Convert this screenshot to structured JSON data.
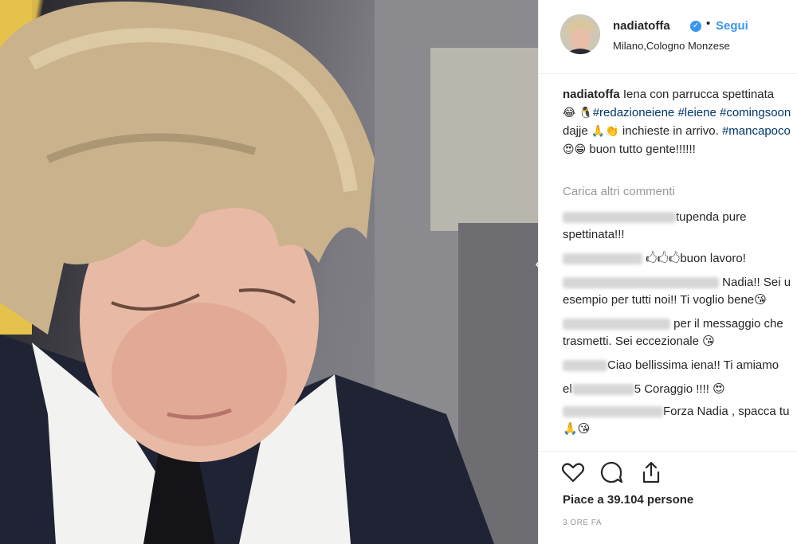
{
  "post": {
    "username": "nadiatoffa",
    "verified_mark": "✓",
    "separator": "•",
    "follow_label": "Segui",
    "location": "Milano,Cologno Monzese"
  },
  "caption": {
    "username": "nadiatoffa",
    "text1": " Iena con parrucca spettinata ",
    "emoji1": "😂 🐧 ",
    "tag1": "#redazioneiene",
    "tag2": " #leiene",
    "tag3": "#comingsoon",
    "text2": " dajje ",
    "emoji2": "🙏👏",
    "text3": " inchieste in arrivo. ",
    "tag4": "#mancapoco",
    "emoji3": " 😍😁",
    "text4": " buon tutto gente!!!!!!"
  },
  "load_more_label": "Carica altri commenti",
  "comments": [
    {
      "text": "tupenda pure spettinata!!!"
    },
    {
      "text": "🖒🖒🖒buon lavoro!"
    },
    {
      "text": "Nadia!! Sei u",
      "text_line2": "esempio per tutti noi!! Ti voglio bene😘"
    },
    {
      "text": "per il messaggio che",
      "text_line2": "trasmetti. Sei eccezionale 😘"
    },
    {
      "text": "Ciao bellissima iena!! Ti amiamo"
    },
    {
      "prefix": "el",
      "text": "5 Coraggio !!!! 😍"
    },
    {
      "text": "Forza Nadia , spacca tu",
      "text_line2": "🙏😘"
    }
  ],
  "actions": {
    "likes_text": "Piace a 39.104 persone",
    "time_text": "3 ORE FA"
  },
  "icons": {
    "like": "heart-icon",
    "comment": "comment-icon",
    "share": "share-icon",
    "verified": "verified-badge-icon"
  },
  "colors": {
    "link_blue": "#3897f0",
    "hashtag": "#003569",
    "muted": "#999999"
  }
}
